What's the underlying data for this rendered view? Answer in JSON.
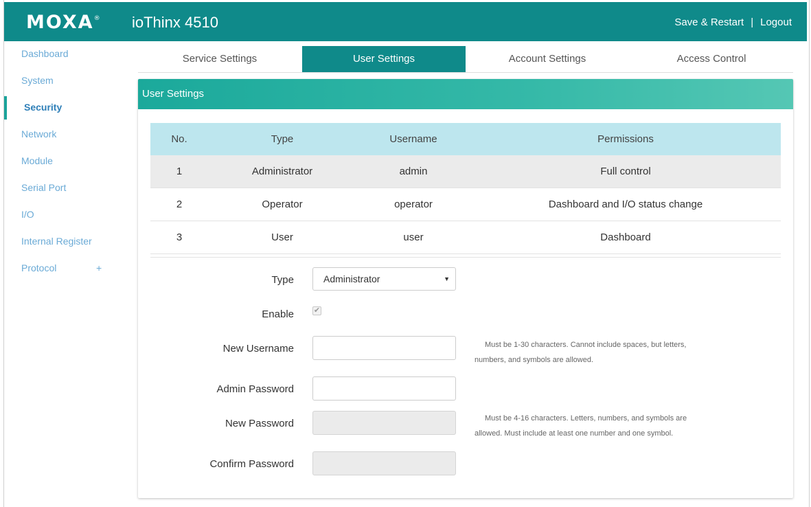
{
  "header": {
    "logo_text": "MOXA",
    "logo_mark": "®",
    "product": "ioThinx 4510",
    "save_restart": "Save & Restart",
    "separator": "|",
    "logout": "Logout"
  },
  "sidebar": {
    "items": [
      {
        "label": "Dashboard"
      },
      {
        "label": "System"
      },
      {
        "label": "Security"
      },
      {
        "label": "Network"
      },
      {
        "label": "Module"
      },
      {
        "label": "Serial Port"
      },
      {
        "label": "I/O"
      },
      {
        "label": "Internal Register"
      },
      {
        "label": "Protocol"
      }
    ],
    "active": "Security",
    "expand_symbol": "+"
  },
  "tabs": [
    {
      "label": "Service Settings"
    },
    {
      "label": "User Settings"
    },
    {
      "label": "Account Settings"
    },
    {
      "label": "Access Control"
    }
  ],
  "active_tab": "User Settings",
  "panel": {
    "title": "User Settings"
  },
  "table": {
    "headers": [
      "No.",
      "Type",
      "Username",
      "Permissions"
    ],
    "rows": [
      [
        "1",
        "Administrator",
        "admin",
        "Full control"
      ],
      [
        "2",
        "Operator",
        "operator",
        "Dashboard and I/O status change"
      ],
      [
        "3",
        "User",
        "user",
        "Dashboard"
      ]
    ],
    "selected_row": 1
  },
  "form": {
    "type_label": "Type",
    "type_value": "Administrator",
    "enable_label": "Enable",
    "enable_checked": true,
    "new_username_label": "New Username",
    "new_username_value": "",
    "username_hint_1": "Must be 1-30 characters. Cannot include spaces, but letters,",
    "username_hint_2": "numbers, and symbols are allowed.",
    "admin_password_label": "Admin Password",
    "admin_password_value": "",
    "new_password_label": "New Password",
    "password_hint_1": "Must be 4-16 characters. Letters, numbers, and symbols are",
    "password_hint_2": "allowed. Must include at least one number and one symbol.",
    "confirm_password_label": "Confirm Password"
  },
  "colors": {
    "brand_teal": "#0f8a8a",
    "panel_header": "#1ba99b",
    "table_header": "#bde6ee",
    "sidebar_link": "#6aaad6"
  }
}
